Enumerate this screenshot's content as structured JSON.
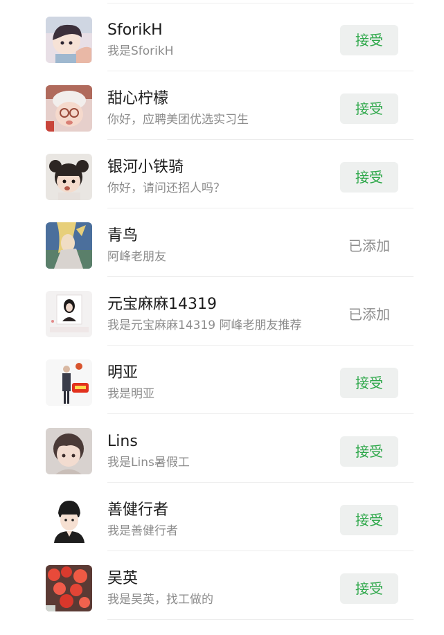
{
  "requests": [
    {
      "name": "SforikH",
      "message": "我是SforikH",
      "action": "接受",
      "status": "pending"
    },
    {
      "name": "甜心柠檬",
      "message": "你好，应聘美团优选实习生",
      "action": "接受",
      "status": "pending"
    },
    {
      "name": "银河小铁骑",
      "message": "你好，请问还招人吗？",
      "action": "接受",
      "status": "pending"
    },
    {
      "name": "青鸟",
      "message": "阿峰老朋友",
      "action": "已添加",
      "status": "added"
    },
    {
      "name": "元宝麻麻14319",
      "message": "我是元宝麻麻14319  阿峰老朋友推荐",
      "action": "已添加",
      "status": "added"
    },
    {
      "name": "明亚",
      "message": "我是明亚",
      "action": "接受",
      "status": "pending"
    },
    {
      "name": "Lins",
      "message": "我是Lins暑假工",
      "action": "接受",
      "status": "pending"
    },
    {
      "name": "善健行者",
      "message": "我是善健行者",
      "action": "接受",
      "status": "pending"
    },
    {
      "name": "吴英",
      "message": "我是吴英，找工做的",
      "action": "接受",
      "status": "pending"
    }
  ],
  "colors": {
    "accept_text": "#2ea84a",
    "accept_bg": "#eef0ef",
    "added_text": "#8c8c8c",
    "name_text": "#1b1b1b",
    "message_text": "#8c8c8c"
  }
}
